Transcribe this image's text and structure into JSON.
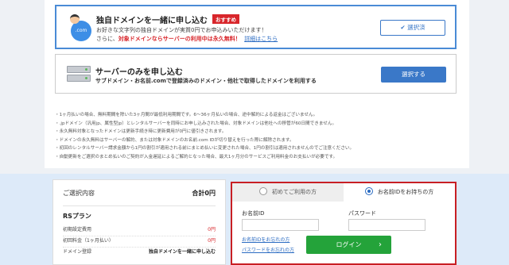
{
  "options": {
    "domain_plus_server": {
      "title": "独自ドメインを一緒に申し込む",
      "badge": "おすすめ",
      "globe_label": ".com",
      "desc1": "お好きな文字列の独自ドメインが実質0円でお申込みいただけます！",
      "desc2_prefix": "さらに、",
      "desc2_red": "対象ドメインならサーバーの利用中は永久無料！",
      "desc2_link": "詳細はこちら",
      "button": "選択済"
    },
    "server_only": {
      "title": "サーバーのみを申し込む",
      "desc1": "サブドメイン・お名前.comで登録済みのドメイン・他社で取得したドメインを利用する",
      "button": "選択する"
    }
  },
  "notes": [
    "1ヶ月払いの場合、無料期間を除いた3ヶ月間が最低利用期間です。6～36ヶ月払いの場合、途中解約による返金はございません。",
    ".jpドメイン（汎用jp、属性型jp）とレンタルサーバーを同時にお申し込みされた場合、対象ドメインは他社への移管が60日間できません。",
    "永久無料対象となったドメインは更新手続き時に更新費用が0円に値引きされます。",
    "ドメインの永久無料はサーバーの解約、または対象ドメインのお名前.com IDが切り替えを行った際に解除されます。",
    "初回のレンタルサーバー請求金額から1円の割引が適用される前にまとめ払いに変更された場合、1円の割引は適用されませんのでご注意ください。",
    "自動更新をご選択のまとめ払いのご契約が入金遅延によるご解約となった場合、最大1ヶ月分のサービスご利用料金のお支払いが必要です。"
  ],
  "summary": {
    "header": "ご選択内容",
    "total": "合計0円",
    "plan": "RSプラン",
    "rows": [
      {
        "label": "初期設定費用",
        "value": "0円"
      },
      {
        "label": "初回料金（1ヶ月払い）",
        "value": "0円"
      },
      {
        "label": "ドメイン登録",
        "value": "独自ドメインを一緒に申し込む"
      }
    ]
  },
  "login": {
    "tab_first": "初めてご利用の方",
    "tab_member": "お名前IDをお持ちの方",
    "id_label": "お名前ID",
    "password_label": "パスワード",
    "forgot_id": "お名前IDをお忘れの方",
    "forgot_password": "パスワードをお忘れの方",
    "login_button": "ログイン",
    "arrow": "›"
  },
  "colors": {
    "accent_blue": "#3a78c8",
    "red": "#d8262b",
    "login_green": "#24a33a",
    "highlight_border": "#c81f24"
  }
}
